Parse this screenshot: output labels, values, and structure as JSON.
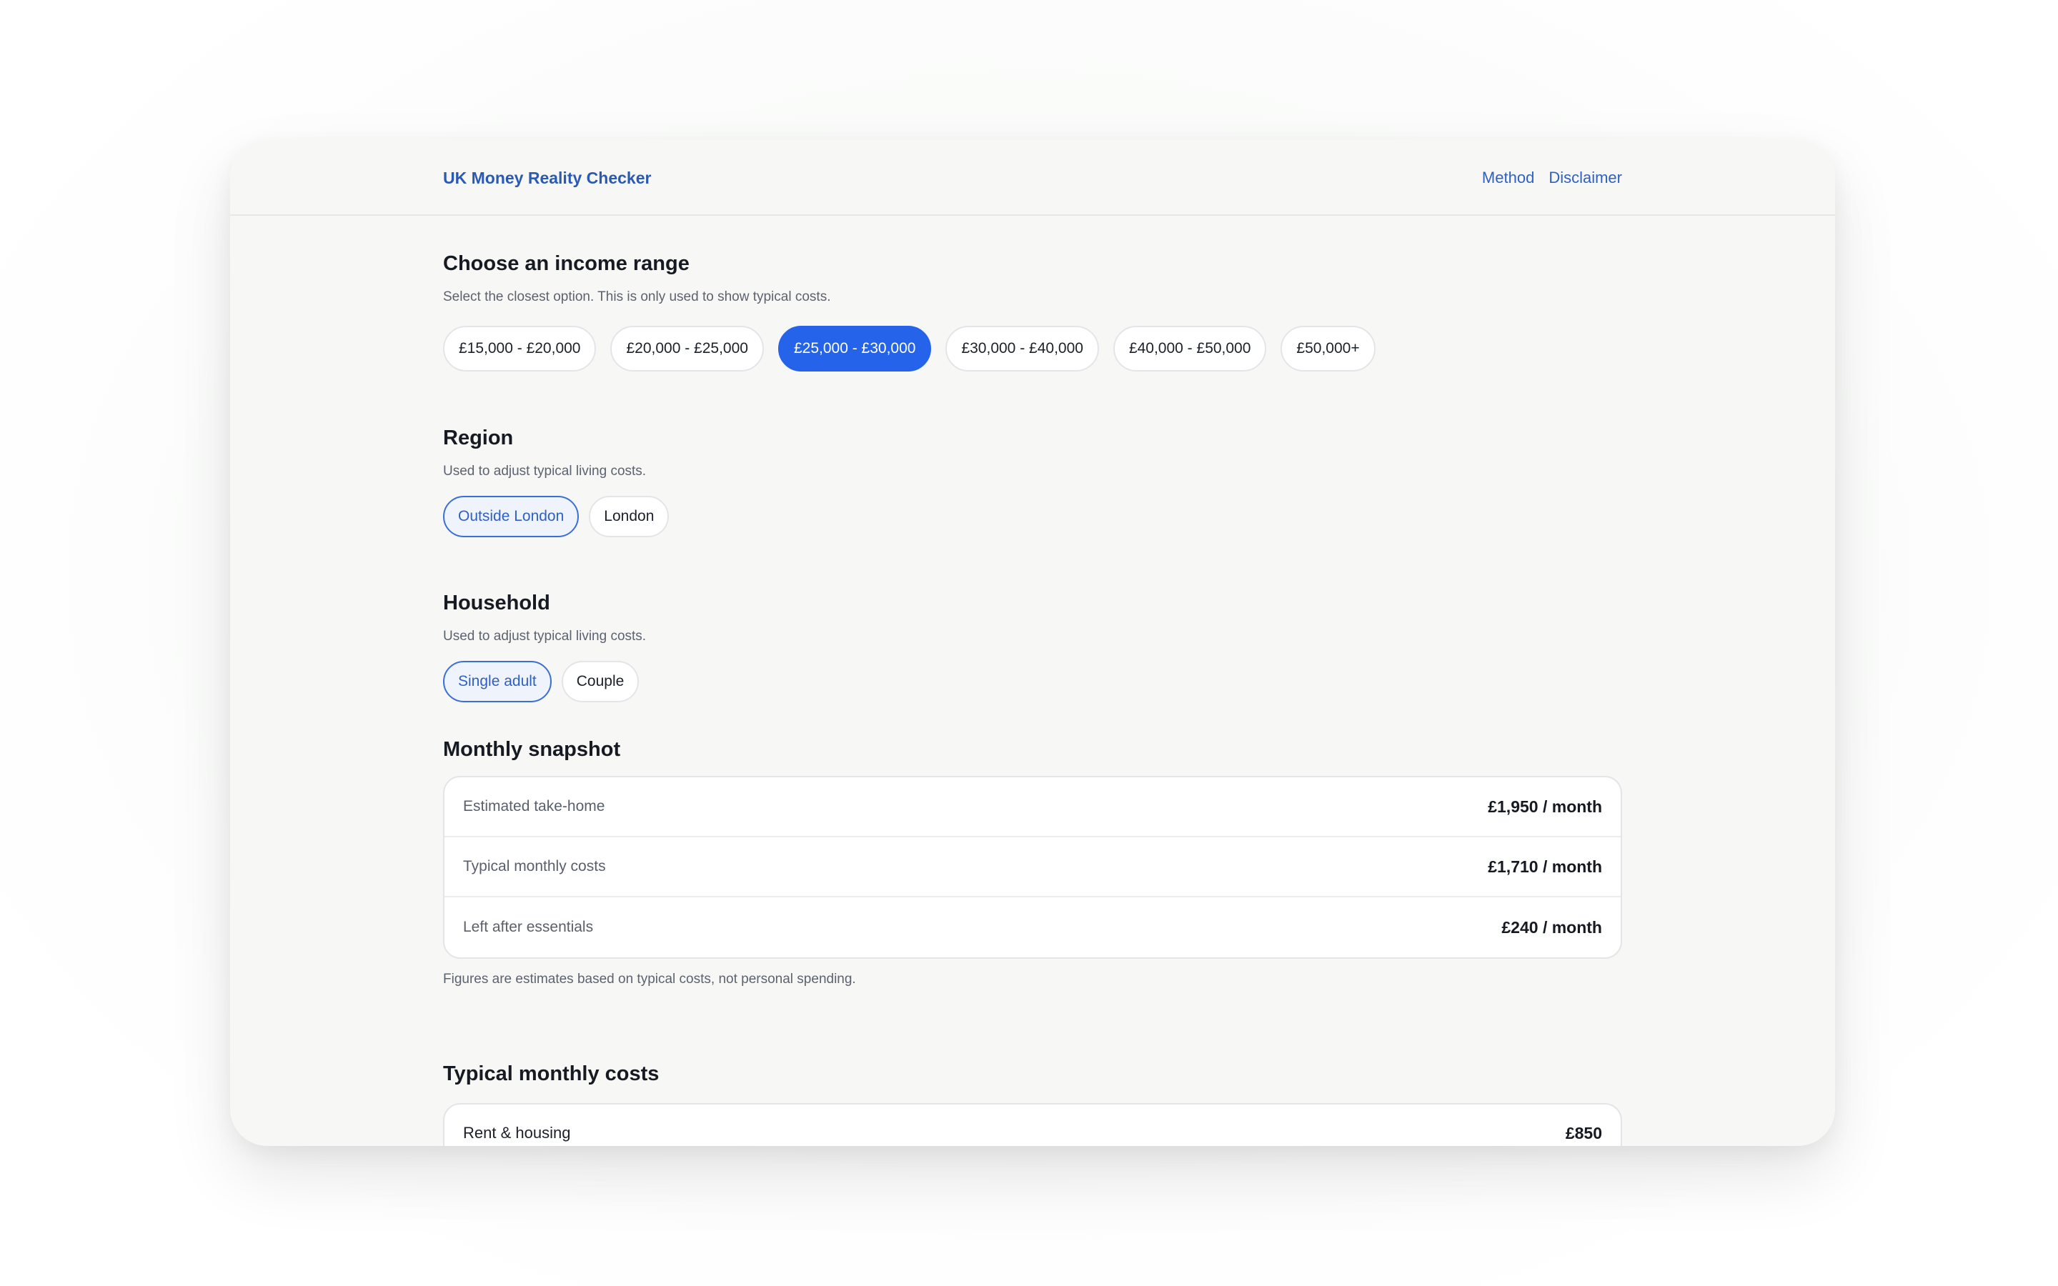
{
  "header": {
    "brand": "UK Money Reality Checker",
    "nav": [
      "Method",
      "Disclaimer"
    ]
  },
  "income": {
    "title": "Choose an income range",
    "subtitle": "Select the closest option. This is only used to show typical costs.",
    "options": [
      "£15,000 - £20,000",
      "£20,000 - £25,000",
      "£25,000 - £30,000",
      "£30,000 - £40,000",
      "£40,000 - £50,000",
      "£50,000+"
    ],
    "selected": "£25,000 - £30,000"
  },
  "region": {
    "title": "Region",
    "subtitle": "Used to adjust typical living costs.",
    "options": [
      "Outside London",
      "London"
    ],
    "selected": "Outside London"
  },
  "household": {
    "title": "Household",
    "subtitle": "Used to adjust typical living costs.",
    "options": [
      "Single adult",
      "Couple"
    ],
    "selected": "Single adult"
  },
  "snapshot": {
    "title": "Monthly snapshot",
    "rows": [
      {
        "label": "Estimated take-home",
        "value": "£1,950 / month"
      },
      {
        "label": "Typical monthly costs",
        "value": "£1,710 / month"
      },
      {
        "label": "Left after essentials",
        "value": "£240 / month"
      }
    ],
    "note": "Figures are estimates based on typical costs, not personal spending."
  },
  "costs": {
    "title": "Typical monthly costs",
    "rows": [
      {
        "label": "Rent & housing",
        "value": "£850"
      }
    ]
  },
  "colors": {
    "accent": "#2563eb",
    "link": "#2f61c4",
    "window_bg": "#f7f7f5"
  }
}
